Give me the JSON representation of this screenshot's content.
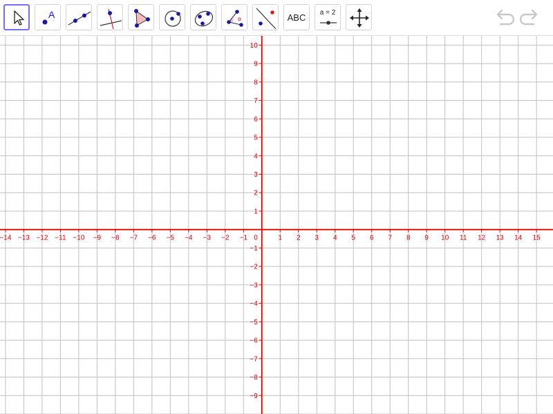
{
  "toolbar": {
    "tools": [
      {
        "name": "move-tool",
        "selected": true
      },
      {
        "name": "point-tool",
        "label": "A"
      },
      {
        "name": "line-tool"
      },
      {
        "name": "perpendicular-line-tool"
      },
      {
        "name": "polygon-tool"
      },
      {
        "name": "circle-tool"
      },
      {
        "name": "conic-tool"
      },
      {
        "name": "angle-tool",
        "label": "α"
      },
      {
        "name": "reflect-tool"
      },
      {
        "name": "text-tool",
        "label": "ABC"
      },
      {
        "name": "slider-tool",
        "label": "a = 2"
      },
      {
        "name": "move-graphics-view-tool"
      }
    ],
    "undo_icon": "undo-icon",
    "redo_icon": "redo-icon"
  },
  "graphics_view": {
    "x_min": -14.3,
    "x_max": 15.9,
    "y_min": -10.0,
    "y_max": 10.5,
    "x_ticks": [
      -14,
      -13,
      -12,
      -11,
      -10,
      -9,
      -8,
      -7,
      -6,
      -5,
      -4,
      -3,
      -2,
      -1,
      1,
      2,
      3,
      4,
      5,
      6,
      7,
      8,
      9,
      10,
      11,
      12,
      13,
      14,
      15
    ],
    "y_ticks": [
      10,
      9,
      8,
      7,
      6,
      5,
      4,
      3,
      2,
      1,
      -1,
      -2,
      -3,
      -4,
      -5,
      -6,
      -7,
      -8,
      -9
    ],
    "origin_label": "0",
    "grid": true,
    "axis_color": "#dd0000",
    "grid_color": "#c0c0c0",
    "label_color": "#cc0000"
  }
}
